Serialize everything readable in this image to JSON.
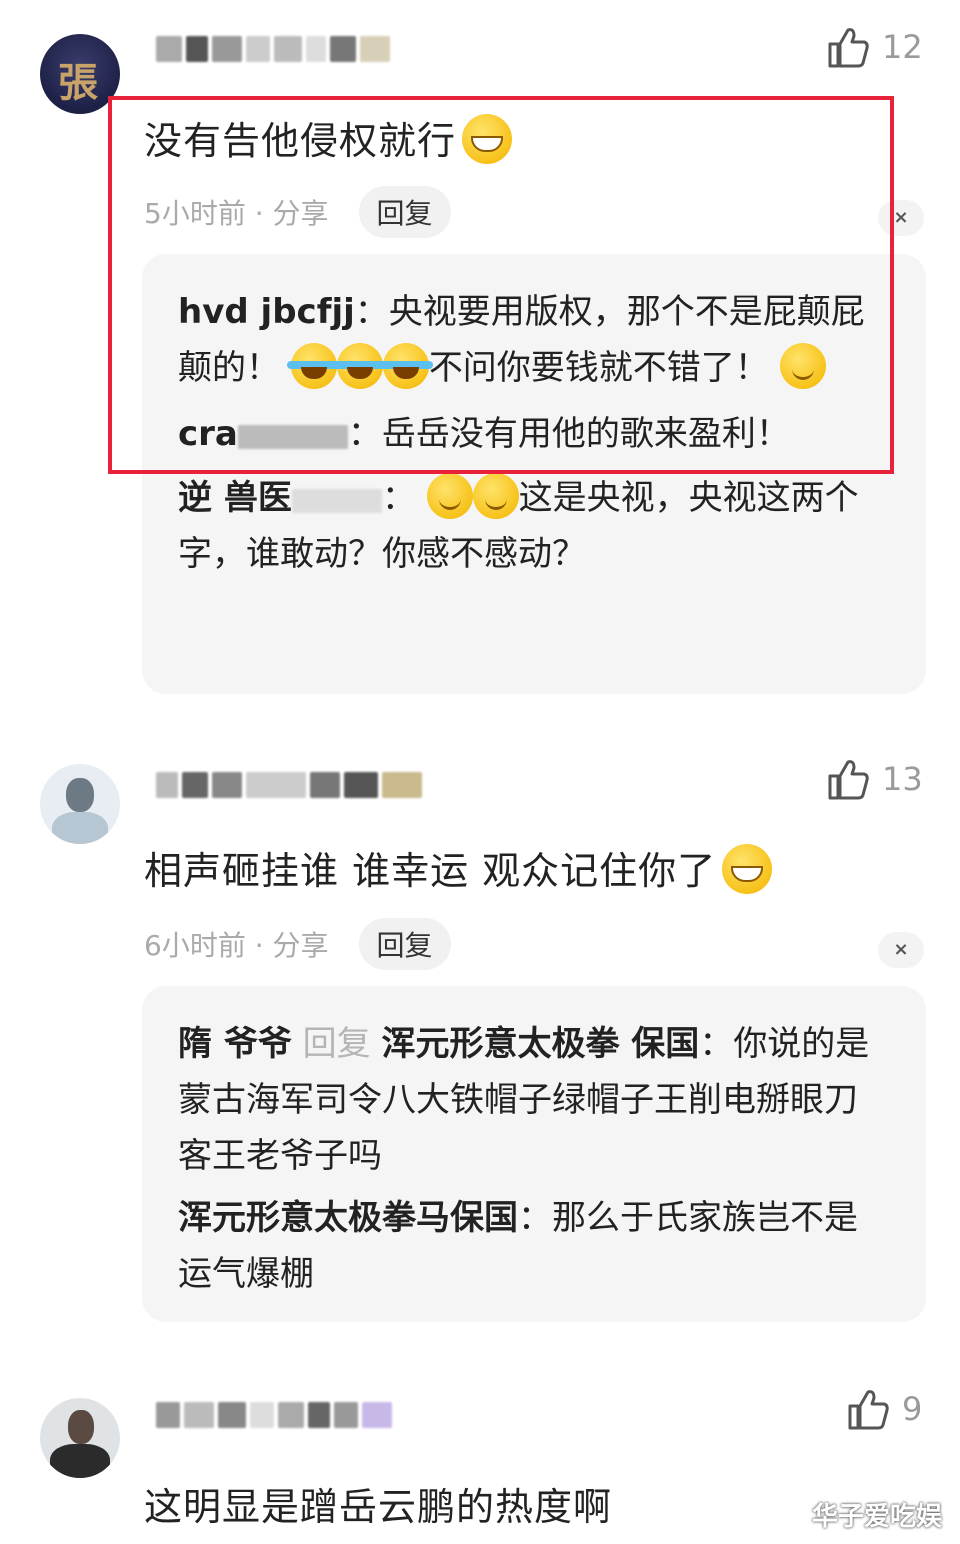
{
  "comments": [
    {
      "likes": "12",
      "text": "没有告他侵权就行",
      "time": "5小时前",
      "share": "· 分享",
      "reply_label": "回复",
      "close_label": "×",
      "replies": [
        {
          "user": "hvd   jbcfjj",
          "sep": "：",
          "text1": "央视要用版权，那个不是屁颠屁颠的！",
          "text2": "不问你要钱就不错了！"
        },
        {
          "user": "cra",
          "sep": "：",
          "text1": "岳岳没有用他的歌来盈利！"
        },
        {
          "user": "逆  兽医",
          "sep": "：",
          "text1": "这是央视，央视这两个字，谁敢动？你感不感动？"
        }
      ]
    },
    {
      "likes": "13",
      "text": "相声砸挂谁 谁幸运 观众记住你了",
      "time": "6小时前",
      "share": "· 分享",
      "reply_label": "回复",
      "close_label": "×",
      "replies": [
        {
          "user": "隋   爷爷",
          "reply_word": "回复",
          "target": "浑元形意太极拳  保国",
          "sep": "：",
          "text1": "你说的是蒙古海军司令八大铁帽子绿帽子王削电掰眼刀客王老爷子吗"
        },
        {
          "user": "浑元形意太极拳马保国",
          "sep": "：",
          "text1": "那么于氏家族岂不是运气爆棚"
        }
      ]
    },
    {
      "likes": "9",
      "text": "这明显是蹭岳云鹏的热度啊"
    }
  ],
  "watermark": "华子爱吃娱"
}
